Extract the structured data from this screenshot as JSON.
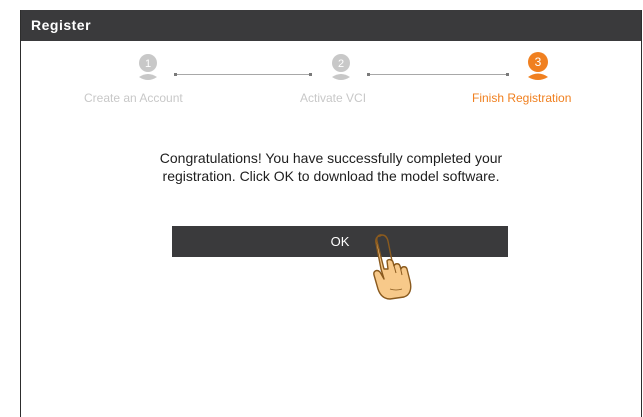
{
  "dialog": {
    "title": "Register"
  },
  "steps": [
    {
      "number": "1",
      "label": "Create an Account",
      "state": "inactive"
    },
    {
      "number": "2",
      "label": "Activate VCI",
      "state": "inactive"
    },
    {
      "number": "3",
      "label": "Finish Registration",
      "state": "active"
    }
  ],
  "message": {
    "line1": "Congratulations! You have successfully completed your",
    "line2": "registration. Click OK to download the model software."
  },
  "ok_button": {
    "label": "OK"
  },
  "colors": {
    "titlebar": "#3a3a3c",
    "active_step": "#f08020",
    "inactive_step": "#c8c8c8",
    "button": "#3a3a3c"
  },
  "icons": {
    "step_badge": "user-step-icon",
    "pointer": "pointing-hand-icon"
  }
}
